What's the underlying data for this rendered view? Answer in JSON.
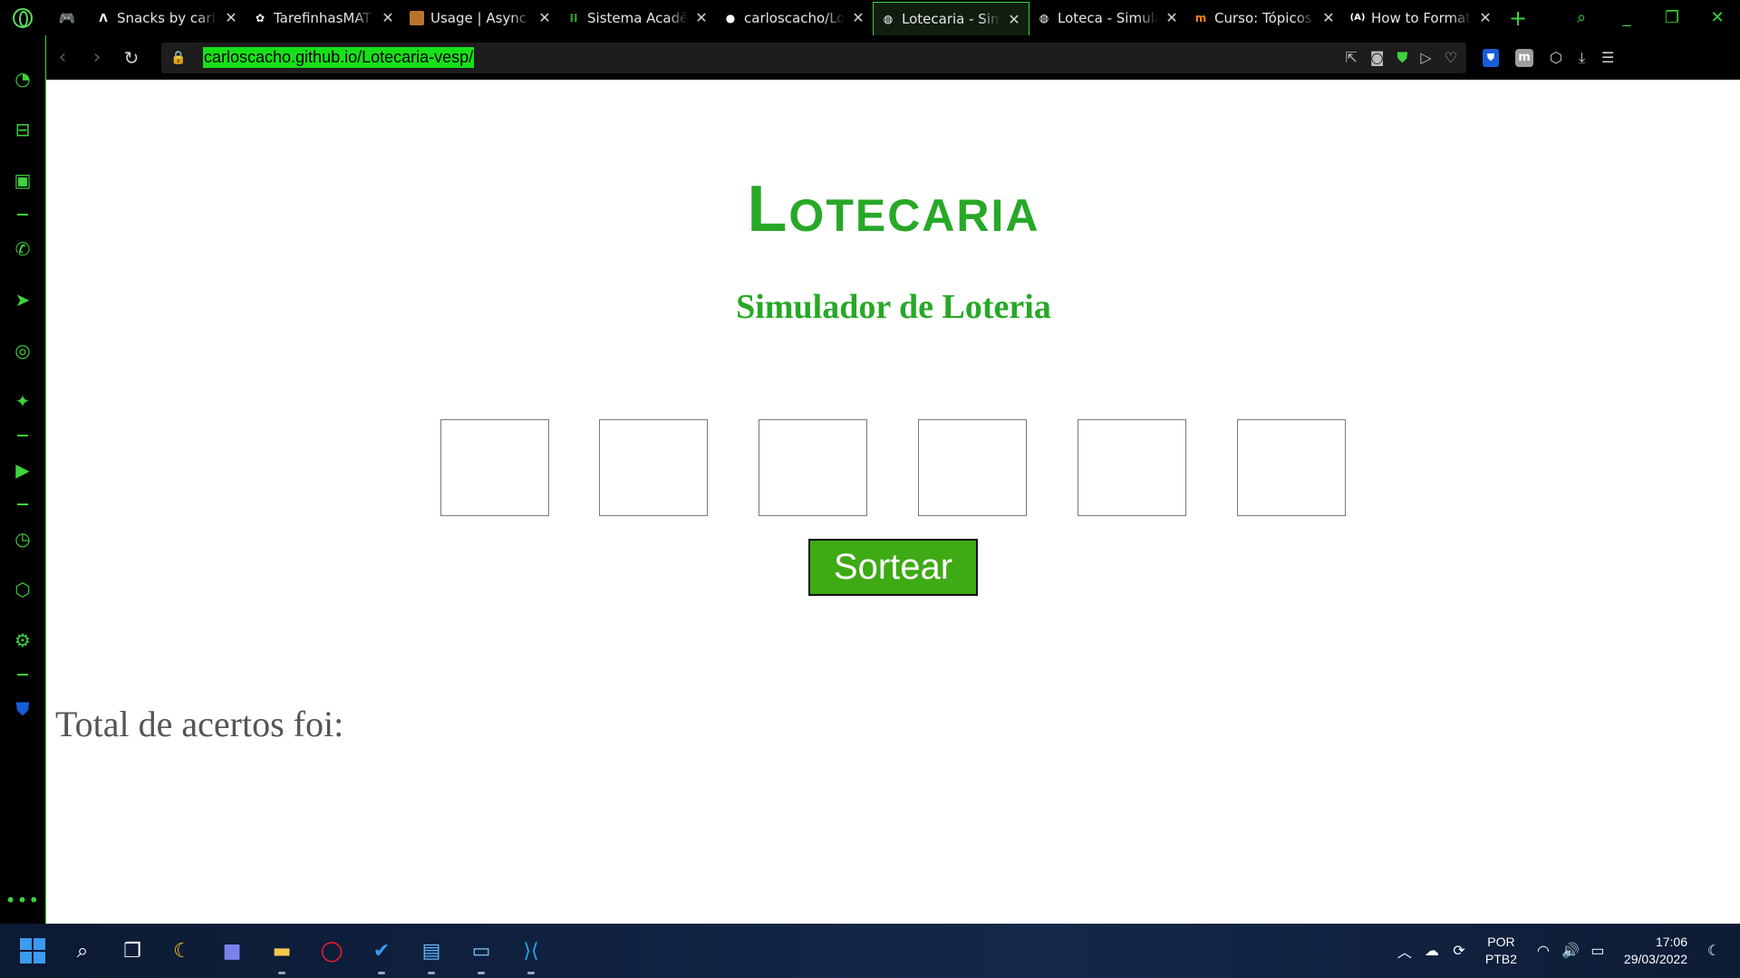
{
  "browser": {
    "tabs": [
      {
        "title": "Snacks by carlos",
        "favicon": "expo-icon"
      },
      {
        "title": "TarefinhasMAT",
        "favicon": "figma-icon"
      },
      {
        "title": "Usage | Async Storage",
        "favicon": "chest-icon"
      },
      {
        "title": "Sistema Acadêmico",
        "favicon": "grid-icon"
      },
      {
        "title": "carloscacho/Lotecaria",
        "favicon": "github-icon"
      },
      {
        "title": "Lotecaria - Simulador",
        "favicon": "globe-icon",
        "active": true
      },
      {
        "title": "Loteca - Simulador",
        "favicon": "globe-icon"
      },
      {
        "title": "Curso: Tópicos Especiais",
        "favicon": "moodle-icon"
      },
      {
        "title": "How to Format",
        "favicon": "a-icon"
      }
    ],
    "url": "carloscacho.github.io/Lotecaria-vesp/"
  },
  "page": {
    "title": "Lotecaria",
    "subtitle": "Simulador de Loteria",
    "number_boxes": [
      "",
      "",
      "",
      "",
      "",
      ""
    ],
    "draw_button_label": "Sortear",
    "result_label": "Total de acertos foi:"
  },
  "taskbar": {
    "language_line1": "POR",
    "language_line2": "PTB2",
    "time": "17:06",
    "date": "29/03/2022"
  },
  "colors": {
    "accent": "#3bd43b",
    "title_green": "#27a827",
    "button_green": "#3eaa14",
    "url_highlight": "#18e018"
  }
}
